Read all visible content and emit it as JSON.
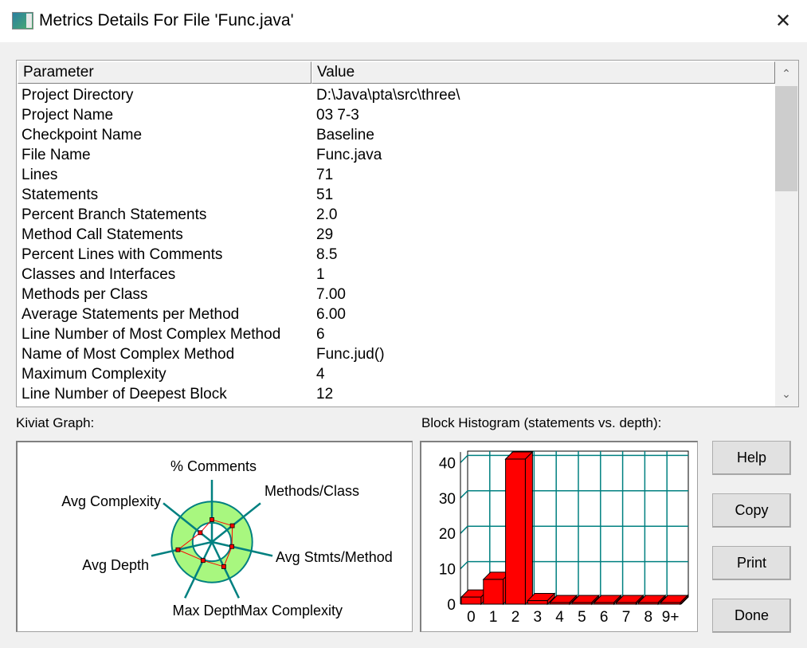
{
  "window": {
    "title": "Metrics Details For File 'Func.java'",
    "close": "✕"
  },
  "table": {
    "headers": [
      "Parameter",
      "Value"
    ],
    "rows": [
      [
        "Project Directory",
        "D:\\Java\\pta\\src\\three\\"
      ],
      [
        "Project Name",
        "03 7-3"
      ],
      [
        "Checkpoint Name",
        "Baseline"
      ],
      [
        "File Name",
        "Func.java"
      ],
      [
        "Lines",
        "71"
      ],
      [
        "Statements",
        "51"
      ],
      [
        "Percent Branch Statements",
        "2.0"
      ],
      [
        "Method Call Statements",
        "29"
      ],
      [
        "Percent Lines with Comments",
        "8.5"
      ],
      [
        "Classes and Interfaces",
        "1"
      ],
      [
        "Methods per Class",
        "7.00"
      ],
      [
        "Average Statements per Method",
        "6.00"
      ],
      [
        "Line Number of Most Complex Method",
        "6"
      ],
      [
        "Name of Most Complex Method",
        "Func.jud()"
      ],
      [
        "Maximum Complexity",
        "4"
      ],
      [
        "Line Number of Deepest Block",
        "12"
      ]
    ],
    "scroll_up": "⌃",
    "scroll_down": "⌄"
  },
  "kiviat": {
    "label": "Kiviat Graph:"
  },
  "histogram": {
    "label": "Block Histogram (statements vs. depth):"
  },
  "buttons": {
    "help": "Help",
    "copy": "Copy",
    "print": "Print",
    "done": "Done"
  },
  "chart_data": [
    {
      "type": "radar",
      "title": "Kiviat Graph",
      "axes": [
        "% Comments",
        "Methods/Class",
        "Avg Stmts/Method",
        "Max Complexity",
        "Max Depth",
        "Avg Depth",
        "Avg Complexity"
      ],
      "values": [
        0.36,
        0.42,
        0.33,
        0.44,
        0.33,
        0.56,
        0.24
      ],
      "normal_range": [
        0.31,
        0.65
      ],
      "colors": {
        "ring": "#a8f77f",
        "axis": "#008080",
        "line": "#ff0000"
      }
    },
    {
      "type": "bar",
      "title": "Block Histogram (statements vs. depth)",
      "categories": [
        "0",
        "1",
        "2",
        "3",
        "4",
        "5",
        "6",
        "7",
        "8",
        "9+"
      ],
      "values": [
        2,
        7,
        41,
        1,
        0,
        0,
        0,
        0,
        0,
        0
      ],
      "yticks": [
        0,
        10,
        20,
        30,
        40
      ],
      "ylim": [
        0,
        43
      ],
      "colors": {
        "bar": "#ff0000",
        "grid": "#008080"
      }
    }
  ]
}
